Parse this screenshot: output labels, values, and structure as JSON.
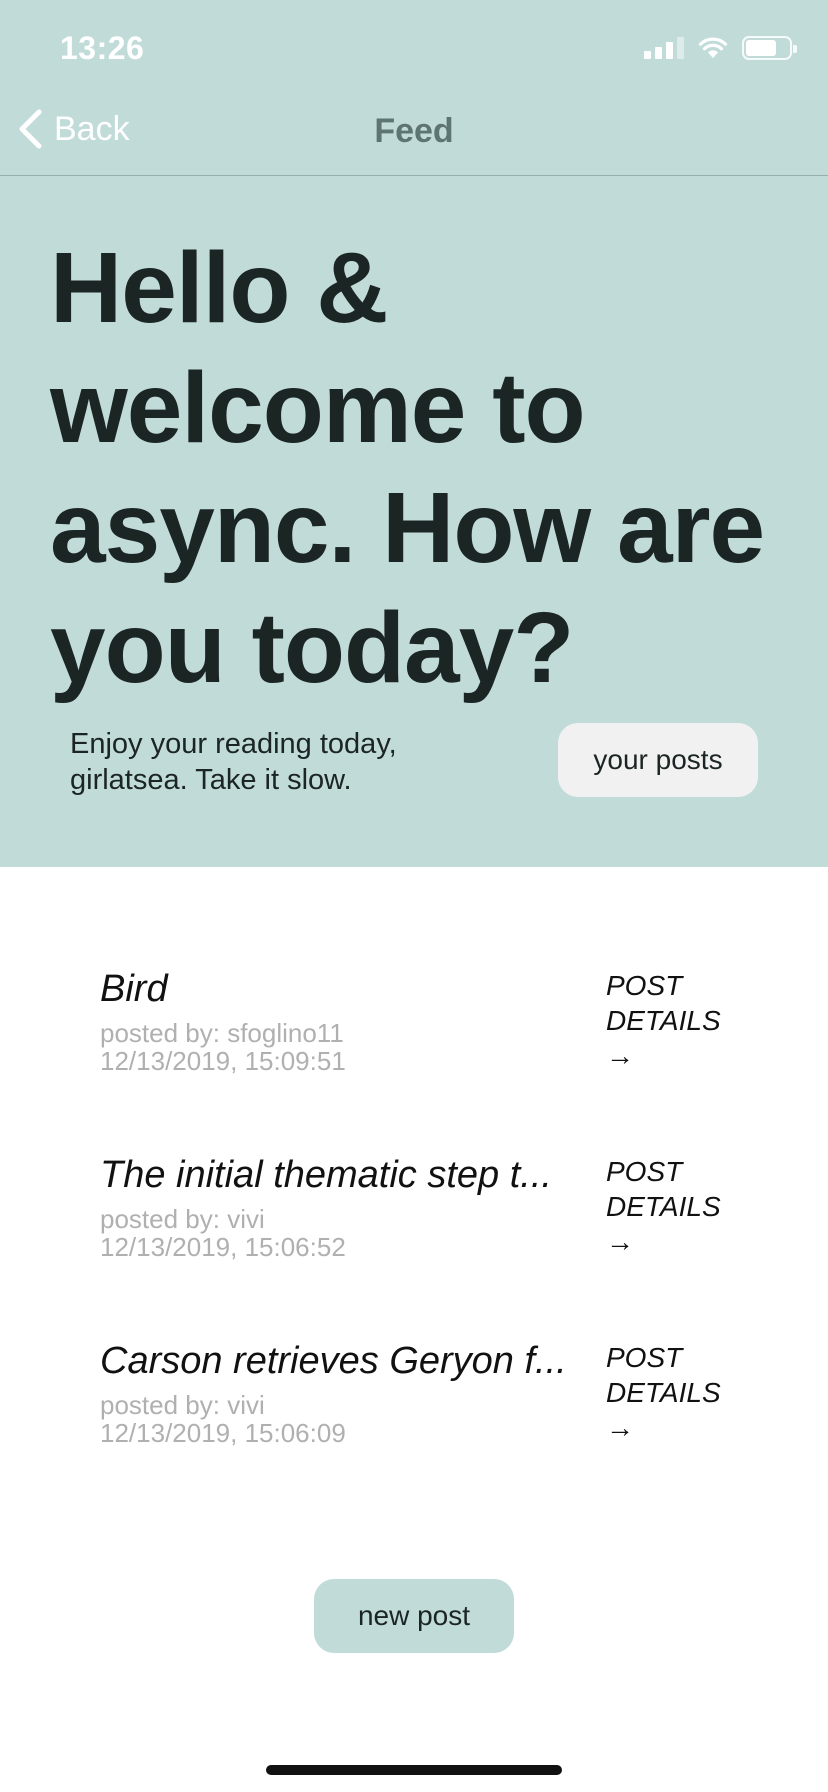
{
  "status_bar": {
    "time": "13:26",
    "signal_icon": "cellular-signal-icon",
    "wifi_icon": "wifi-icon",
    "battery_icon": "battery-icon"
  },
  "nav": {
    "back_label": "Back",
    "back_icon": "chevron-left-icon",
    "title": "Feed"
  },
  "hero": {
    "title": "Hello & welcome to async. How are you today?",
    "subtitle": "Enjoy your reading today, girlatsea. Take it slow.",
    "your_posts_label": "your posts"
  },
  "posts": [
    {
      "title": "Bird",
      "author": "posted by: sfoglino11",
      "date": "12/13/2019, 15:09:51",
      "details_label": "POST DETAILS",
      "arrow": "→"
    },
    {
      "title": "The initial thematic step t...",
      "author": "posted by: vivi",
      "date": "12/13/2019, 15:06:52",
      "details_label": "POST DETAILS",
      "arrow": "→"
    },
    {
      "title": "Carson retrieves Geryon f...",
      "author": "posted by: vivi",
      "date": "12/13/2019, 15:06:09",
      "details_label": "POST DETAILS",
      "arrow": "→"
    }
  ],
  "new_post_label": "new post",
  "colors": {
    "header_bg": "#c1dbd9",
    "heading_text": "#1b2524",
    "meta_text": "#b0b0b0",
    "button_light": "#f1f1f1"
  }
}
